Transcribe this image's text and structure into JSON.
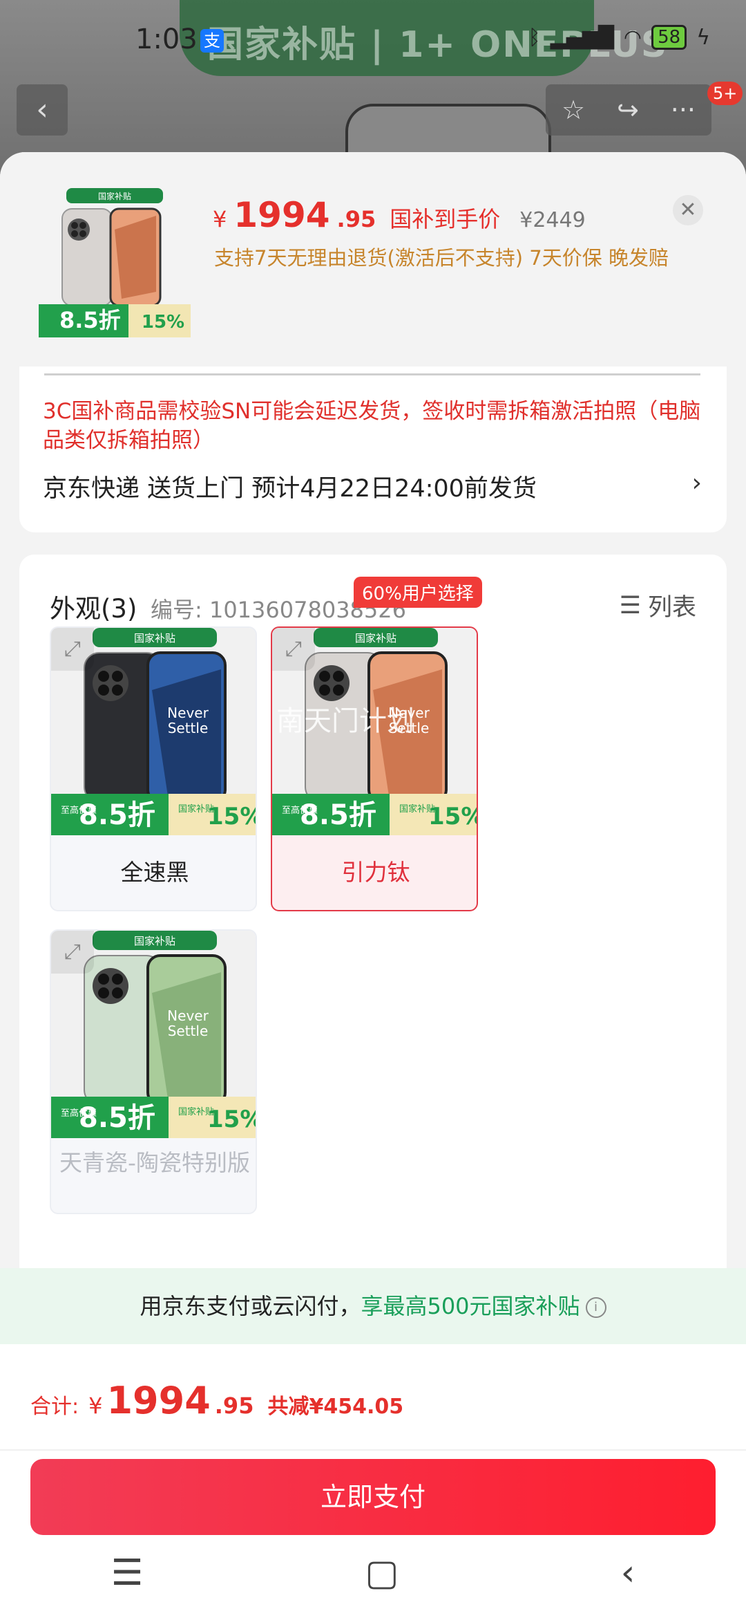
{
  "status_bar": {
    "time": "1:03",
    "app_icon_glyph": "支",
    "battery": "58"
  },
  "header": {
    "banner_text": "国家补贴 | 1+ ONEPLUS",
    "notification_count": "5+"
  },
  "summary": {
    "currency": "¥",
    "price_int": "1994",
    "price_dec": ".95",
    "price_tag": "国补到手价",
    "original_price": "¥2449",
    "promises": "支持7天无理由退货(激活后不支持)  7天价保  晚发赔"
  },
  "delivery": {
    "warning": "3C国补商品需校验SN可能会延迟发货，签收时需拆箱激活拍照（电脑品类仅拆箱拍照）",
    "shipping": "京东快递  送货上门  预计4月22日24:00前发货"
  },
  "appearance": {
    "title": "外观(3)",
    "item_no": "编号: 10136078038526",
    "list_label": "列表",
    "pick_badge": "60%用户选择",
    "watermark": "南天门计划",
    "options": [
      {
        "label": "全速黑",
        "body": "#2c2d31",
        "screen": "#2f5fa8",
        "screen2": "#0e1e3e"
      },
      {
        "label": "引力钛",
        "body": "#d8d4d1",
        "screen": "#e9a07a",
        "screen2": "#b8562e"
      },
      {
        "label": "天青瓷-陶瓷特别版",
        "body": "#cfe0cf",
        "screen": "#a9cc9a",
        "screen2": "#6e9a60"
      }
    ],
    "promo": {
      "top_banner": "国家补贴",
      "brand": "ONEPLUS",
      "side_tag": "至高优惠",
      "discount": "8.5折",
      "subsidy_tag": "国家补贴",
      "subsidy_pct": "15%",
      "phone_text_1": "Never",
      "phone_text_2": "Settle"
    }
  },
  "pay_notice": {
    "prefix": "用京东支付或云闪付，",
    "highlight": "享最高500元国家补贴"
  },
  "total": {
    "label": "合计:",
    "currency": "¥",
    "amount_int": "1994",
    "amount_dec": ".95",
    "saving": "共减¥454.05"
  },
  "pay_button": "立即支付",
  "colors": {
    "accent_red": "#e5302c",
    "promo_orange": "#c7852c",
    "subsidy_green": "#1a9f5a"
  }
}
